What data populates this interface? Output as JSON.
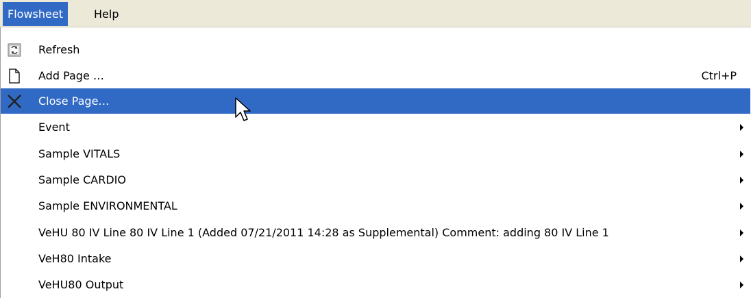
{
  "menubar": {
    "items": [
      {
        "label": "Flowsheet"
      },
      {
        "label": "Help"
      }
    ]
  },
  "menu": {
    "items": [
      {
        "label": "Refresh",
        "icon": "refresh-icon"
      },
      {
        "label": "Add Page …",
        "icon": "page-icon",
        "shortcut": "Ctrl+P"
      },
      {
        "label": "Close Page…",
        "icon": "close-icon"
      },
      {
        "label": "Event",
        "submenu": true
      },
      {
        "label": "Sample VITALS",
        "submenu": true
      },
      {
        "label": "Sample CARDIO",
        "submenu": true
      },
      {
        "label": "Sample ENVIRONMENTAL",
        "submenu": true
      },
      {
        "label": "VeHU 80 IV Line 80 IV Line 1 (Added 07/21/2011 14:28 as Supplemental) Comment: adding 80 IV Line 1",
        "submenu": true
      },
      {
        "label": "VeH80 Intake",
        "submenu": true
      },
      {
        "label": "VeHU80 Output",
        "submenu": true
      }
    ]
  },
  "colors": {
    "highlight": "#316ac5",
    "menubar_bg": "#ece9d8"
  }
}
